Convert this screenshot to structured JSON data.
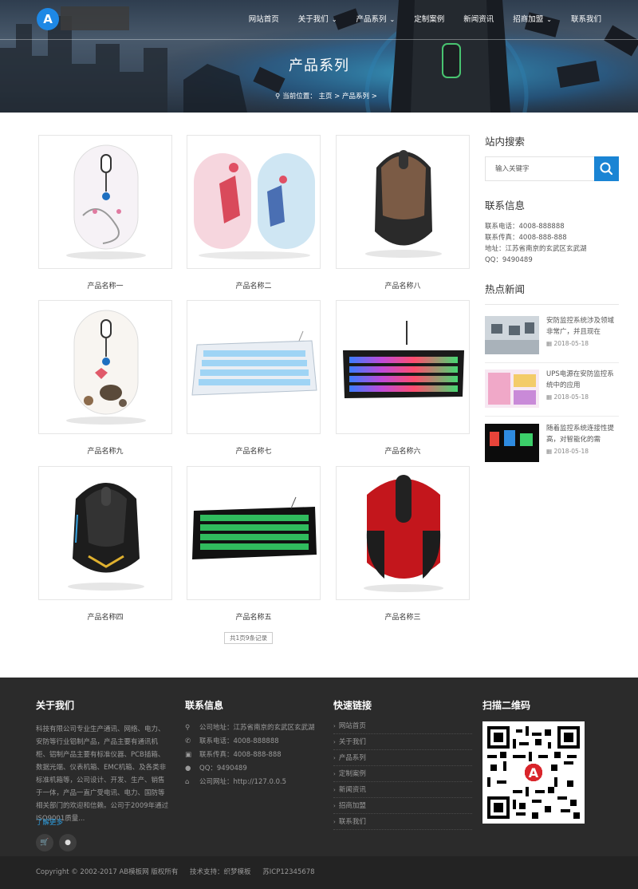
{
  "colors": {
    "accent": "#1a84d4",
    "footer_bg": "#2b2b2b",
    "copyright_bg": "#232323",
    "link": "#2d9ee0"
  },
  "header": {
    "nav": [
      {
        "label": "网站首页",
        "dropdown": false
      },
      {
        "label": "关于我们",
        "dropdown": true
      },
      {
        "label": "产品系列",
        "dropdown": true
      },
      {
        "label": "定制案例",
        "dropdown": false
      },
      {
        "label": "新闻资讯",
        "dropdown": false
      },
      {
        "label": "招商加盟",
        "dropdown": true
      },
      {
        "label": "联系我们",
        "dropdown": false
      }
    ],
    "title": "产品系列",
    "breadcrumb": {
      "prefix": "当前位置：",
      "home": "主页",
      "sep": ">",
      "current": "产品系列",
      "tail": ">"
    }
  },
  "products": [
    {
      "name": "产品名称一",
      "kind": "mouse-white"
    },
    {
      "name": "产品名称二",
      "kind": "mouse-pair"
    },
    {
      "name": "产品名称八",
      "kind": "mouse-brown"
    },
    {
      "name": "产品名称九",
      "kind": "mouse-white-bird"
    },
    {
      "name": "产品名称七",
      "kind": "keyboard-white"
    },
    {
      "name": "产品名称六",
      "kind": "keyboard-rgb"
    },
    {
      "name": "产品名称四",
      "kind": "mouse-black"
    },
    {
      "name": "产品名称五",
      "kind": "keyboard-green"
    },
    {
      "name": "产品名称三",
      "kind": "mouse-red"
    }
  ],
  "pagination": {
    "text": "共1页9条记录"
  },
  "sidebar": {
    "search": {
      "title": "站内搜索",
      "placeholder": "输入关键字",
      "button_icon": "search-icon"
    },
    "contact": {
      "title": "联系信息",
      "lines": [
        "联系电话：4008-888888",
        "联系传真：4008-888-888",
        "地址：江苏省南京的玄武区玄武湖",
        "QQ：9490489"
      ]
    },
    "news": {
      "title": "热点新闻",
      "items": [
        {
          "title": "安防监控系统涉及领域非常广，并且现在",
          "date": "2018-05-18"
        },
        {
          "title": "UPS电源在安防监控系统中的应用",
          "date": "2018-05-18"
        },
        {
          "title": "随着监控系统连接性提高，对智能化的需",
          "date": "2018-05-18"
        }
      ]
    }
  },
  "footer": {
    "about": {
      "title": "关于我们",
      "text": "科技有限公司专业生产通讯、网络、电力、安防等行业铝制产品，产品主要有通讯机柜、铝制产品主要有标准仪器、PCB插箱、数据光端、仪表机箱、EMC机箱、及各类非标准机箱等，公司设计、开发、生产、销售于一体，产品一直广受电讯、电力、国防等相关部门的欢迎和信赖。公司于2009年通过ISO9001质量...",
      "more": "了解更多"
    },
    "contact": {
      "title": "联系信息",
      "lines": [
        {
          "icon": "location-icon",
          "text": "公司地址：江苏省南京的玄武区玄武湖"
        },
        {
          "icon": "phone-icon",
          "text": "联系电话：4008-888888"
        },
        {
          "icon": "fax-icon",
          "text": "联系传真：4008-888-888"
        },
        {
          "icon": "qq-icon",
          "text": "QQ：9490489"
        },
        {
          "icon": "home-icon",
          "text": "公司网址：http://127.0.0.5"
        }
      ]
    },
    "links": {
      "title": "快速链接",
      "items": [
        "网站首页",
        "关于我们",
        "产品系列",
        "定制案例",
        "新闻资讯",
        "招商加盟",
        "联系我们"
      ]
    },
    "qr": {
      "title": "扫描二维码"
    },
    "copyright": [
      "Copyright © 2002-2017 AB模板网 版权所有",
      "技术支持：织梦模板",
      "苏ICP12345678"
    ]
  }
}
